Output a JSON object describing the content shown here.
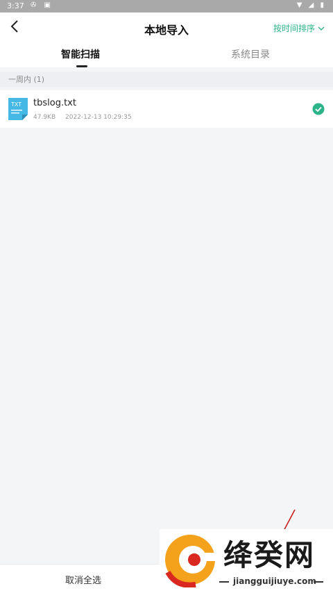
{
  "status": {
    "time": "3:37"
  },
  "nav": {
    "title": "本地导入",
    "sort_label": "按时间排序"
  },
  "tabs": [
    {
      "label": "智能扫描"
    },
    {
      "label": "系统目录"
    }
  ],
  "section": {
    "title": "一周内 (1)"
  },
  "files": [
    {
      "icon_label": "TXT",
      "name": "tbslog.txt",
      "size": "47.9KB",
      "date": "2022-12-13 10:29:35"
    }
  ],
  "bottom": {
    "cancel_label": "取消全选"
  },
  "watermark": {
    "brand": "绛癸网",
    "url": "jiangguijiuye.com"
  },
  "colors": {
    "accent": "#2db38a",
    "file_icon": "#46b8e6"
  }
}
